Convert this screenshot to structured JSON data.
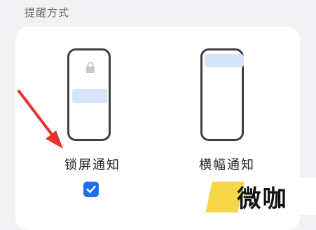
{
  "section": {
    "title": "提醒方式"
  },
  "options": [
    {
      "label": "锁屏通知",
      "checked": true,
      "icon": "lock-icon",
      "preview_color": "#d4e5fb"
    },
    {
      "label": "横幅通知",
      "checked": false,
      "preview_color": "#d4e5fb"
    }
  ],
  "colors": {
    "accent": "#1e6ff0",
    "annotation_arrow": "#e8302f",
    "card": "#ffffff",
    "background": "#f2f2f4"
  },
  "watermark": {
    "text": "微咖"
  }
}
